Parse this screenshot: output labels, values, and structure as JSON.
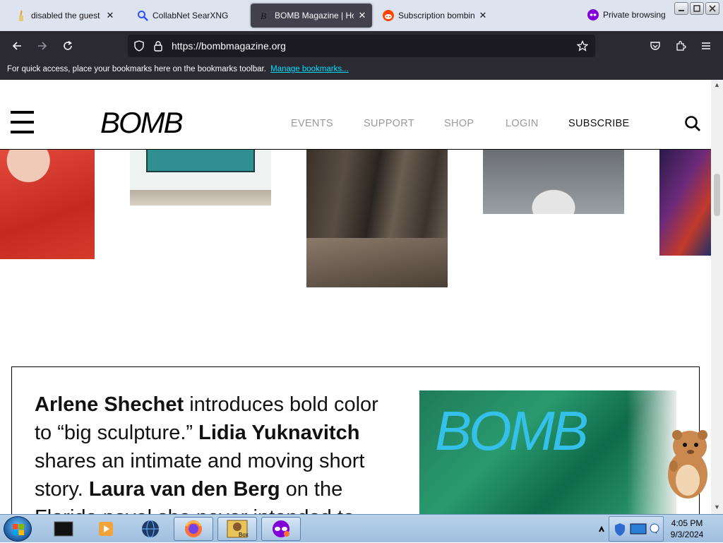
{
  "browser": {
    "tabs": [
      {
        "title": "disabled the guest fon",
        "favicon": "candle-icon",
        "active": false
      },
      {
        "title": "CollabNet SearXNG",
        "favicon": "magnifier-icon",
        "active": false
      },
      {
        "title": "BOMB Magazine | Ho",
        "favicon": "bomb-b-icon",
        "active": true
      },
      {
        "title": "Subscription bombing",
        "favicon": "reddit-icon",
        "active": false
      }
    ],
    "private_label": "Private browsing",
    "url": "https://bombmagazine.org",
    "bookmarks_text": "For quick access, place your bookmarks here on the bookmarks toolbar.",
    "bookmarks_link": "Manage bookmarks..."
  },
  "site": {
    "logo": "BOMB",
    "nav": [
      "EVENTS",
      "SUPPORT",
      "SHOP",
      "LOGIN",
      "SUBSCRIBE"
    ],
    "feature": {
      "segments": [
        {
          "text": "Arlene Shechet",
          "bold": true
        },
        {
          "text": " introduces bold color to “big sculpture.” ",
          "bold": false
        },
        {
          "text": "Lidia Yuknavitch",
          "bold": true
        },
        {
          "text": " shares an intimate and moving short story. ",
          "bold": false
        },
        {
          "text": "Laura van den Berg",
          "bold": true
        },
        {
          "text": " on the Florida novel she never intended to",
          "bold": false
        }
      ],
      "image_logo": "BOMB"
    }
  },
  "taskbar": {
    "time": "4:05 PM",
    "date": "9/3/2024",
    "items": [
      "terminal-icon",
      "media-player-icon",
      "globe-icon",
      "firefox-icon",
      "sandboxie-icon",
      "private-browsing-icon"
    ]
  },
  "colors": {
    "tabstrip_bg": "#dde4f0",
    "toolbar_bg": "#2b2a33",
    "accent_link": "#00ddff",
    "feature_logo": "#35c0ea"
  }
}
